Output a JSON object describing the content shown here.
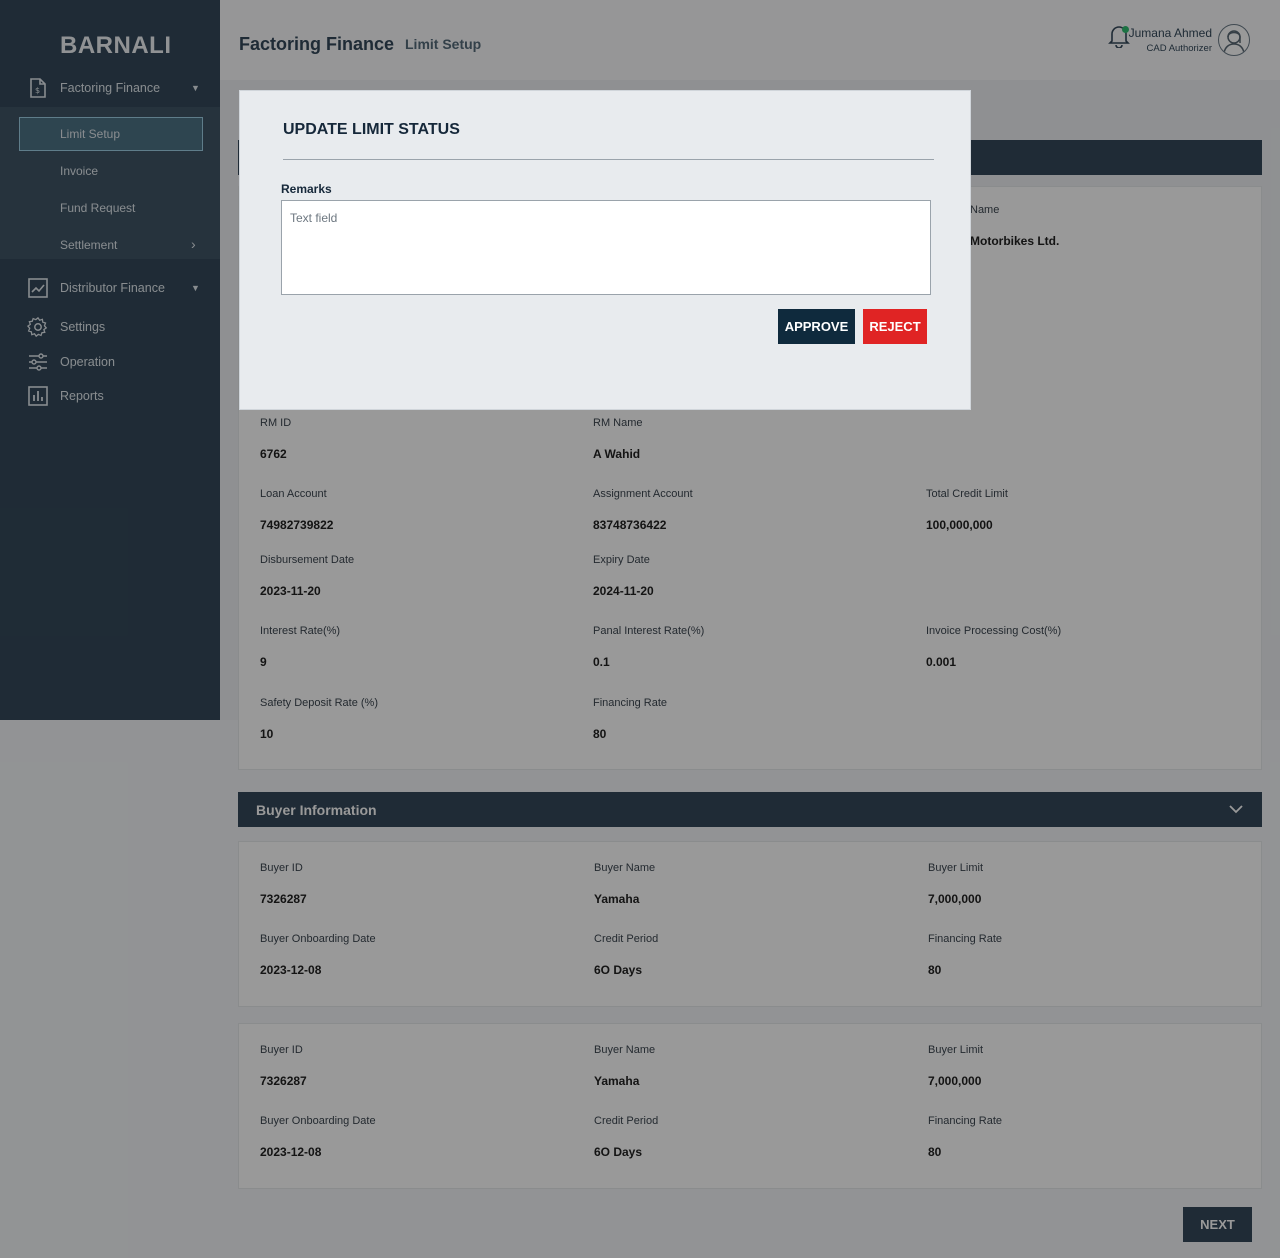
{
  "app": {
    "brand": "BARNALI"
  },
  "sidebar": {
    "items": [
      {
        "label": "Factoring Finance",
        "icon": "document-icon"
      },
      {
        "label": "Distributor Finance",
        "icon": "trend-chart-icon"
      },
      {
        "label": "Settings",
        "icon": "gear-icon"
      },
      {
        "label": "Operation",
        "icon": "sliders-icon"
      },
      {
        "label": "Reports",
        "icon": "bar-chart-icon"
      }
    ],
    "submenu": [
      {
        "label": "Limit Setup",
        "active": true
      },
      {
        "label": "Invoice"
      },
      {
        "label": "Fund Request"
      },
      {
        "label": "Settlement"
      }
    ]
  },
  "header": {
    "title": "Factoring Finance",
    "subtitle": "Limit Setup",
    "user_name": "Jumana Ahmed",
    "user_role": "CAD Authorizer"
  },
  "limit_info": {
    "partial_label": "Name",
    "partial_value": "Motorbikes Ltd.",
    "fields": [
      {
        "label": "RM ID",
        "value": "6762"
      },
      {
        "label": "RM Name",
        "value": "A Wahid"
      },
      {
        "label": "Loan Account",
        "value": "74982739822"
      },
      {
        "label": "Assignment Account",
        "value": "83748736422"
      },
      {
        "label": "Total Credit Limit",
        "value": "100,000,000"
      },
      {
        "label": "Disbursement Date",
        "value": "2023-11-20"
      },
      {
        "label": "Expiry Date",
        "value": "2024-11-20"
      },
      {
        "label": "Interest Rate(%)",
        "value": "9"
      },
      {
        "label": "Panal Interest Rate(%)",
        "value": "0.1"
      },
      {
        "label": "Invoice Processing Cost(%)",
        "value": "0.001"
      },
      {
        "label": "Safety Deposit Rate (%)",
        "value": "10"
      },
      {
        "label": "Financing Rate",
        "value": "80"
      }
    ]
  },
  "buyer_section": {
    "title": "Buyer Information",
    "buyers": [
      {
        "fields": [
          {
            "label": "Buyer ID",
            "value": "7326287"
          },
          {
            "label": "Buyer Name",
            "value": "Yamaha"
          },
          {
            "label": "Buyer Limit",
            "value": "7,000,000"
          },
          {
            "label": "Buyer Onboarding Date",
            "value": "2023-12-08"
          },
          {
            "label": "Credit Period",
            "value": "6O Days"
          },
          {
            "label": "Financing Rate",
            "value": "80"
          }
        ]
      },
      {
        "fields": [
          {
            "label": "Buyer ID",
            "value": "7326287"
          },
          {
            "label": "Buyer Name",
            "value": "Yamaha"
          },
          {
            "label": "Buyer Limit",
            "value": "7,000,000"
          },
          {
            "label": "Buyer Onboarding Date",
            "value": "2023-12-08"
          },
          {
            "label": "Credit Period",
            "value": "6O Days"
          },
          {
            "label": "Financing Rate",
            "value": "80"
          }
        ]
      }
    ]
  },
  "next_label": "NEXT",
  "modal": {
    "title": "UPDATE LIMIT STATUS",
    "remarks_label": "Remarks",
    "remarks_placeholder": "Text field",
    "remarks_value": "",
    "approve_label": "APPROVE",
    "reject_label": "REJECT"
  },
  "colors": {
    "sidebar": "#34495a",
    "approve": "#0f2a3d",
    "reject": "#e02424",
    "notification_dot": "#2fbf71"
  }
}
